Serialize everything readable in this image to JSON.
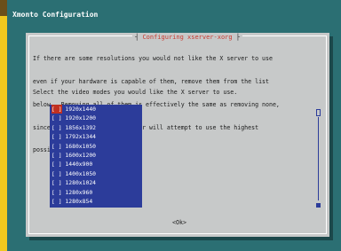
{
  "window": {
    "title": "Xmonto Configuration"
  },
  "dialog": {
    "title": "Configuring xserver-xorg",
    "text_lines": [
      "If there are some resolutions you would not like the X server to use",
      "even if your hardware is capable of them, remove them from the list",
      "below.  Removing all of them is effectively the same as removing none,",
      "since in both cases the X server will attempt to use the highest",
      "possible resolution."
    ],
    "prompt": "Select the video modes you would like the X server to use.",
    "modes": [
      "1920x1440",
      "1920x1200",
      "1856x1392",
      "1792x1344",
      "1680x1050",
      "1600x1200",
      "1440x900",
      "1400x1050",
      "1280x1024",
      "1280x960",
      "1280x854",
      "1280x800"
    ],
    "ok_label": "<Ok>"
  },
  "colors": {
    "background": "#2b6f73",
    "dialog": "#c7c9c9",
    "list_bg": "#2c3c9a",
    "title_accent": "#c83a30",
    "frame": "#f3e03a"
  }
}
